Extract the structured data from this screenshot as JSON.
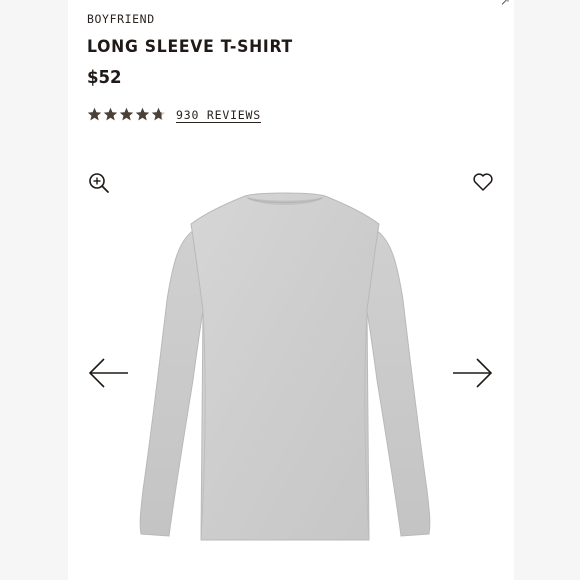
{
  "product": {
    "collection": "BOYFRIEND",
    "title": "LONG SLEEVE T-SHIRT",
    "price": "$52",
    "rating": {
      "stars": 4.7,
      "max": 5,
      "reviews_label": "930 REVIEWS"
    }
  },
  "icons": {
    "zoom": "zoom-in-icon",
    "favorite": "heart-icon",
    "prev": "arrow-left-icon",
    "next": "arrow-right-icon"
  },
  "colors": {
    "text": "#1f1a17",
    "star": "#4a403a",
    "garment": "#cfcfcf",
    "side_panel": "#f6f6f6"
  }
}
